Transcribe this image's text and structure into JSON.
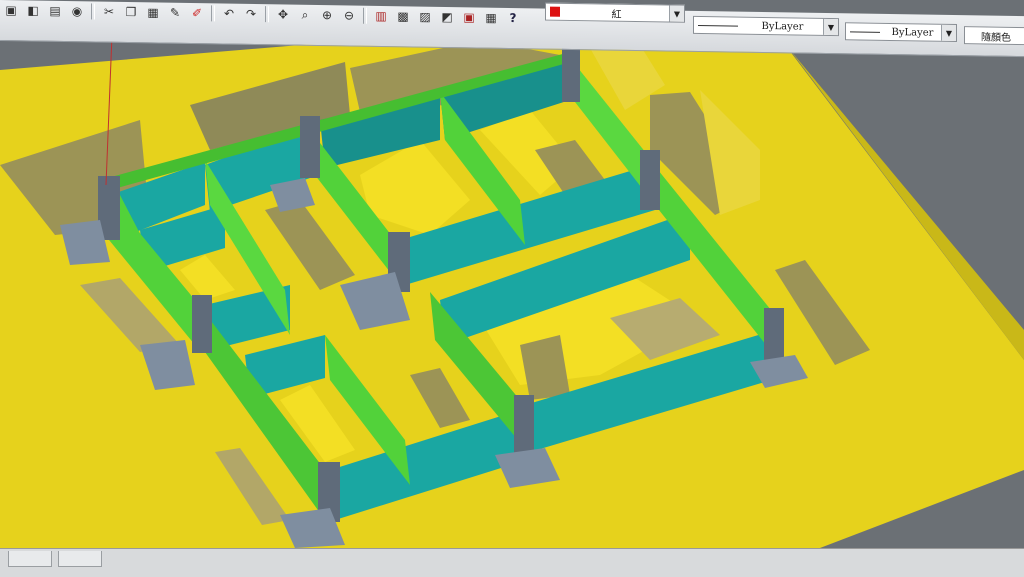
{
  "app": {
    "name": "AutoCAD 3D model view"
  },
  "toolbar": {
    "color_value": "紅",
    "linetype_value": "ByLayer",
    "lineweight_value": "ByLayer",
    "plotstyle_value": "隨顏色",
    "icons": [
      "open-icon",
      "save-icon",
      "print-icon",
      "preview-icon",
      "cut-icon",
      "copy-icon",
      "paste-icon",
      "match-properties-icon",
      "undo-icon",
      "redo-icon",
      "pan-icon",
      "zoom-realtime-icon",
      "zoom-window-icon",
      "zoom-previous-icon",
      "properties-icon",
      "design-center-icon",
      "tool-palettes-icon",
      "sheet-set-icon",
      "markup-icon",
      "calculator-icon",
      "help-icon"
    ]
  },
  "colors": {
    "ground": "#e6d21c",
    "wall_green": "#52d23a",
    "wall_teal": "#1aa7a2",
    "roof_yellow": "#f0dc28",
    "shadow_olive": "#9c9456",
    "column": "#5f6b7a",
    "background": "#6d7277"
  },
  "statusbar": {
    "tabs": [
      "",
      ""
    ]
  }
}
